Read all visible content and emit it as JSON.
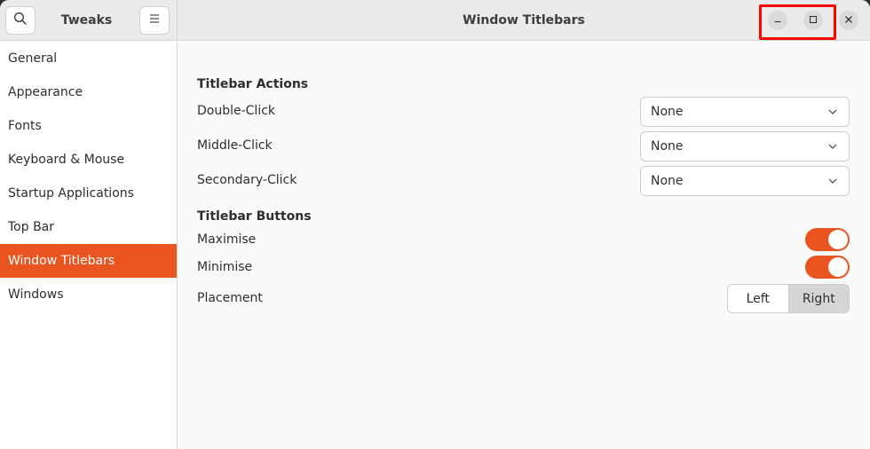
{
  "window": {
    "sidebar_title": "Tweaks",
    "main_title": "Window Titlebars",
    "accent_color": "#e95420"
  },
  "header": {
    "search_icon": "search-icon",
    "menu_icon": "hamburger-menu-icon",
    "window_controls": [
      "minimize-icon",
      "maximize-icon",
      "close-icon"
    ]
  },
  "sidebar": {
    "items": [
      {
        "label": "General",
        "active": false
      },
      {
        "label": "Appearance",
        "active": false
      },
      {
        "label": "Fonts",
        "active": false
      },
      {
        "label": "Keyboard & Mouse",
        "active": false
      },
      {
        "label": "Startup Applications",
        "active": false
      },
      {
        "label": "Top Bar",
        "active": false
      },
      {
        "label": "Window Titlebars",
        "active": true
      },
      {
        "label": "Windows",
        "active": false
      }
    ]
  },
  "main": {
    "titlebar_actions": {
      "title": "Titlebar Actions",
      "rows": [
        {
          "label": "Double-Click",
          "value": "None"
        },
        {
          "label": "Middle-Click",
          "value": "None"
        },
        {
          "label": "Secondary-Click",
          "value": "None"
        }
      ]
    },
    "titlebar_buttons": {
      "title": "Titlebar Buttons",
      "maximise": {
        "label": "Maximise",
        "enabled": true
      },
      "minimise": {
        "label": "Minimise",
        "enabled": true
      },
      "placement": {
        "label": "Placement",
        "options": [
          "Left",
          "Right"
        ],
        "selected": "Right"
      }
    }
  }
}
